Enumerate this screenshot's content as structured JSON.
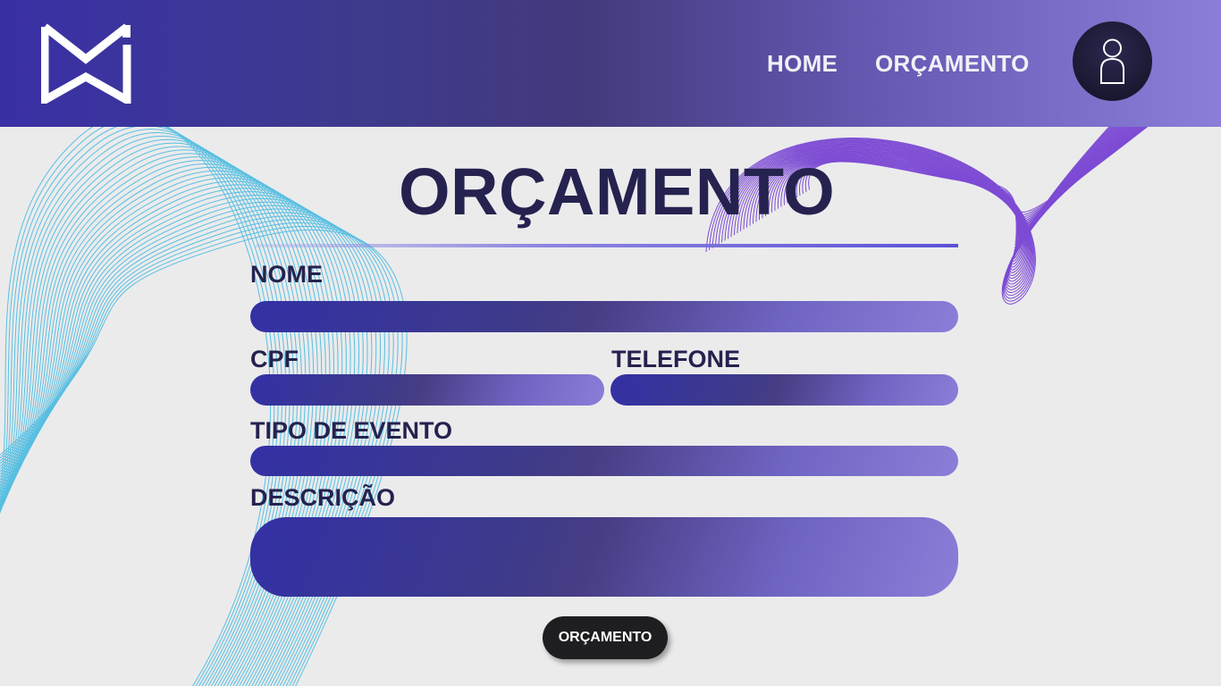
{
  "header": {
    "nav": [
      {
        "label": "HOME"
      },
      {
        "label": "ORÇAMENTO"
      }
    ]
  },
  "form": {
    "title": "ORÇAMENTO",
    "fields": {
      "nome": {
        "label": "NOME",
        "value": ""
      },
      "cpf": {
        "label": "CPF",
        "value": ""
      },
      "telefone": {
        "label": "TELEFONE",
        "value": ""
      },
      "tipo_evento": {
        "label": "TIPO DE EVENTO",
        "value": ""
      },
      "descricao": {
        "label": "DESCRIÇÃO",
        "value": ""
      }
    },
    "submit_label": "ORÇAMENTO"
  },
  "colors": {
    "header_start": "#3a30a6",
    "header_end": "#8a7ed8",
    "title_text": "#25224f",
    "background": "#ebebec",
    "button_bg": "#1e1e20",
    "wave_left": "#3fb8e0",
    "wave_right": "#6a30d0"
  },
  "icons": {
    "logo": "mi-monogram-logo",
    "avatar": "user-icon"
  }
}
